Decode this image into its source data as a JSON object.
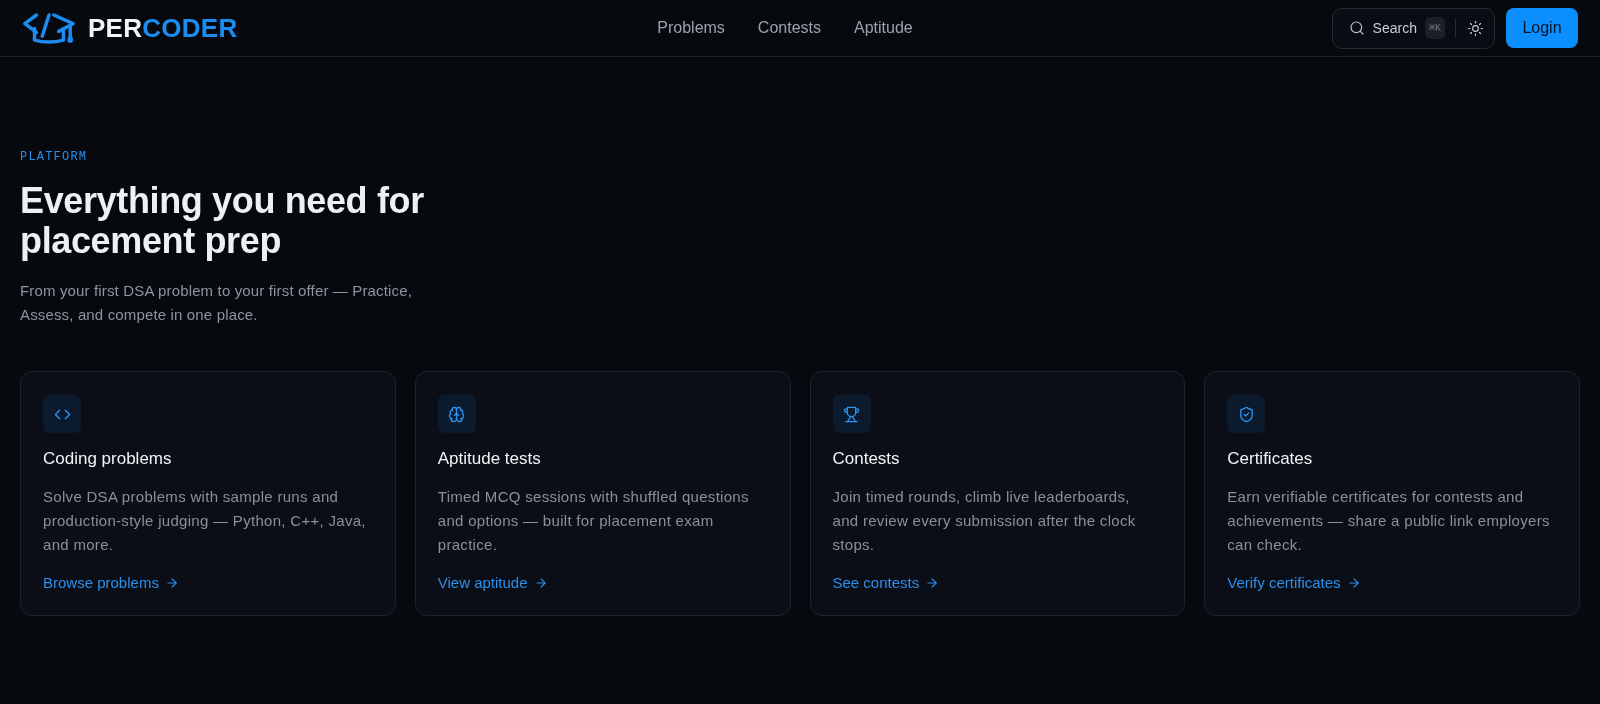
{
  "header": {
    "logo": {
      "text_plain": "PER",
      "text_accent": "CODER"
    },
    "nav": [
      {
        "label": "Problems"
      },
      {
        "label": "Contests"
      },
      {
        "label": "Aptitude"
      }
    ],
    "search": {
      "label": "Search",
      "shortcut": "⌘K"
    },
    "login": "Login"
  },
  "hero": {
    "eyebrow": "PLATFORM",
    "title": "Everything you need for placement prep",
    "subtitle": "From your first DSA problem to your first offer — Practice, Assess, and compete in one place."
  },
  "features": [
    {
      "kind": "code",
      "title": "Coding problems",
      "description": "Solve DSA problems with sample runs and production-style judging — Python, C++, Java, and more.",
      "link": "Browse problems"
    },
    {
      "kind": "brain",
      "title": "Aptitude tests",
      "description": "Timed MCQ sessions with shuffled questions and options — built for placement exam practice.",
      "link": "View aptitude"
    },
    {
      "kind": "trophy",
      "title": "Contests",
      "description": "Join timed rounds, climb live leaderboards, and review every submission after the clock stops.",
      "link": "See contests"
    },
    {
      "kind": "shield",
      "title": "Certificates",
      "description": "Earn verifiable certificates for contests and achievements — share a public link employers can check.",
      "link": "Verify certificates"
    }
  ]
}
